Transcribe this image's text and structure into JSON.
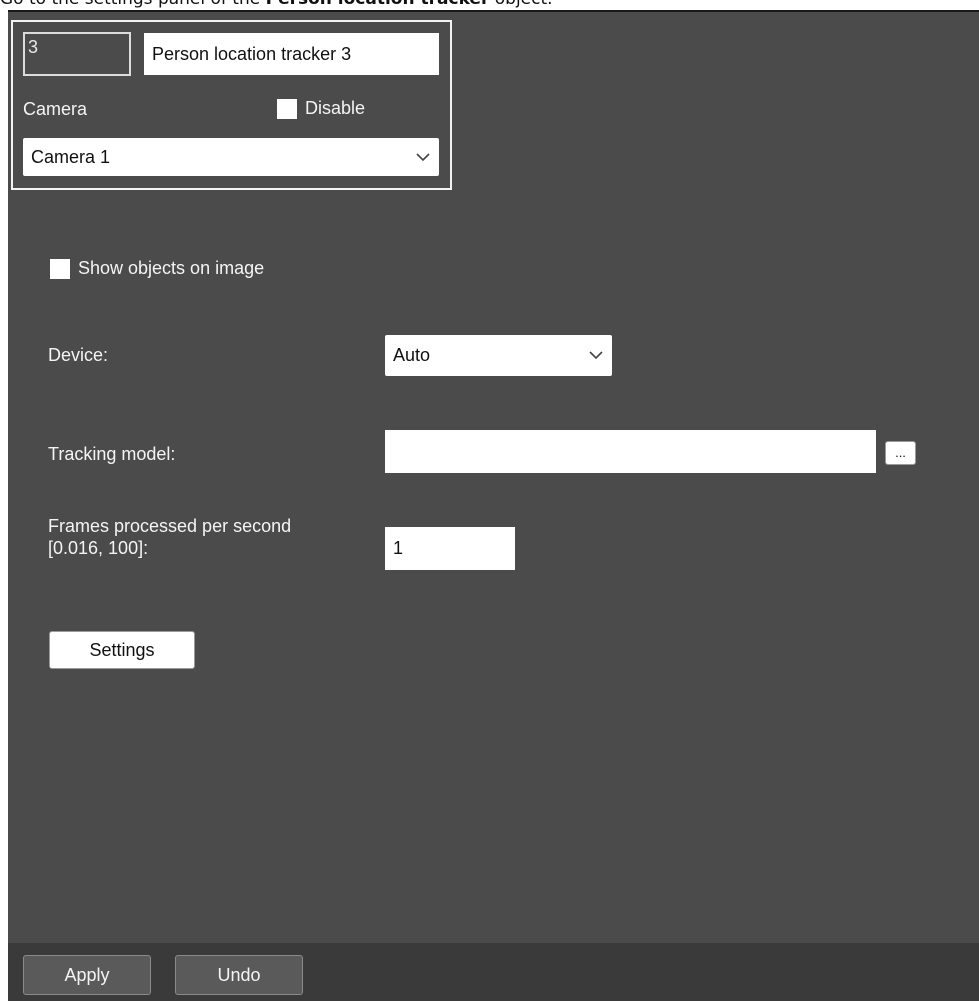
{
  "caption": {
    "pre": "Go to the settings panel of the ",
    "bold": "Person location tracker",
    "post": " object."
  },
  "object": {
    "id": "3",
    "name": "Person location tracker 3",
    "camera_label": "Camera",
    "disable_label": "Disable",
    "disable_checked": false,
    "camera_value": "Camera 1"
  },
  "settings": {
    "show_objects_label": "Show objects on image",
    "show_objects_checked": false,
    "device_label": "Device:",
    "device_value": "Auto",
    "tracking_model_label": "Tracking model:",
    "tracking_model_value": "",
    "browse_label": "...",
    "fps_label_line1": "Frames processed per second",
    "fps_label_line2": "[0.016, 100]:",
    "fps_value": "1",
    "settings_button": "Settings"
  },
  "footer": {
    "apply": "Apply",
    "undo": "Undo"
  },
  "icons": {
    "dropdown": "chevron-down-icon"
  }
}
